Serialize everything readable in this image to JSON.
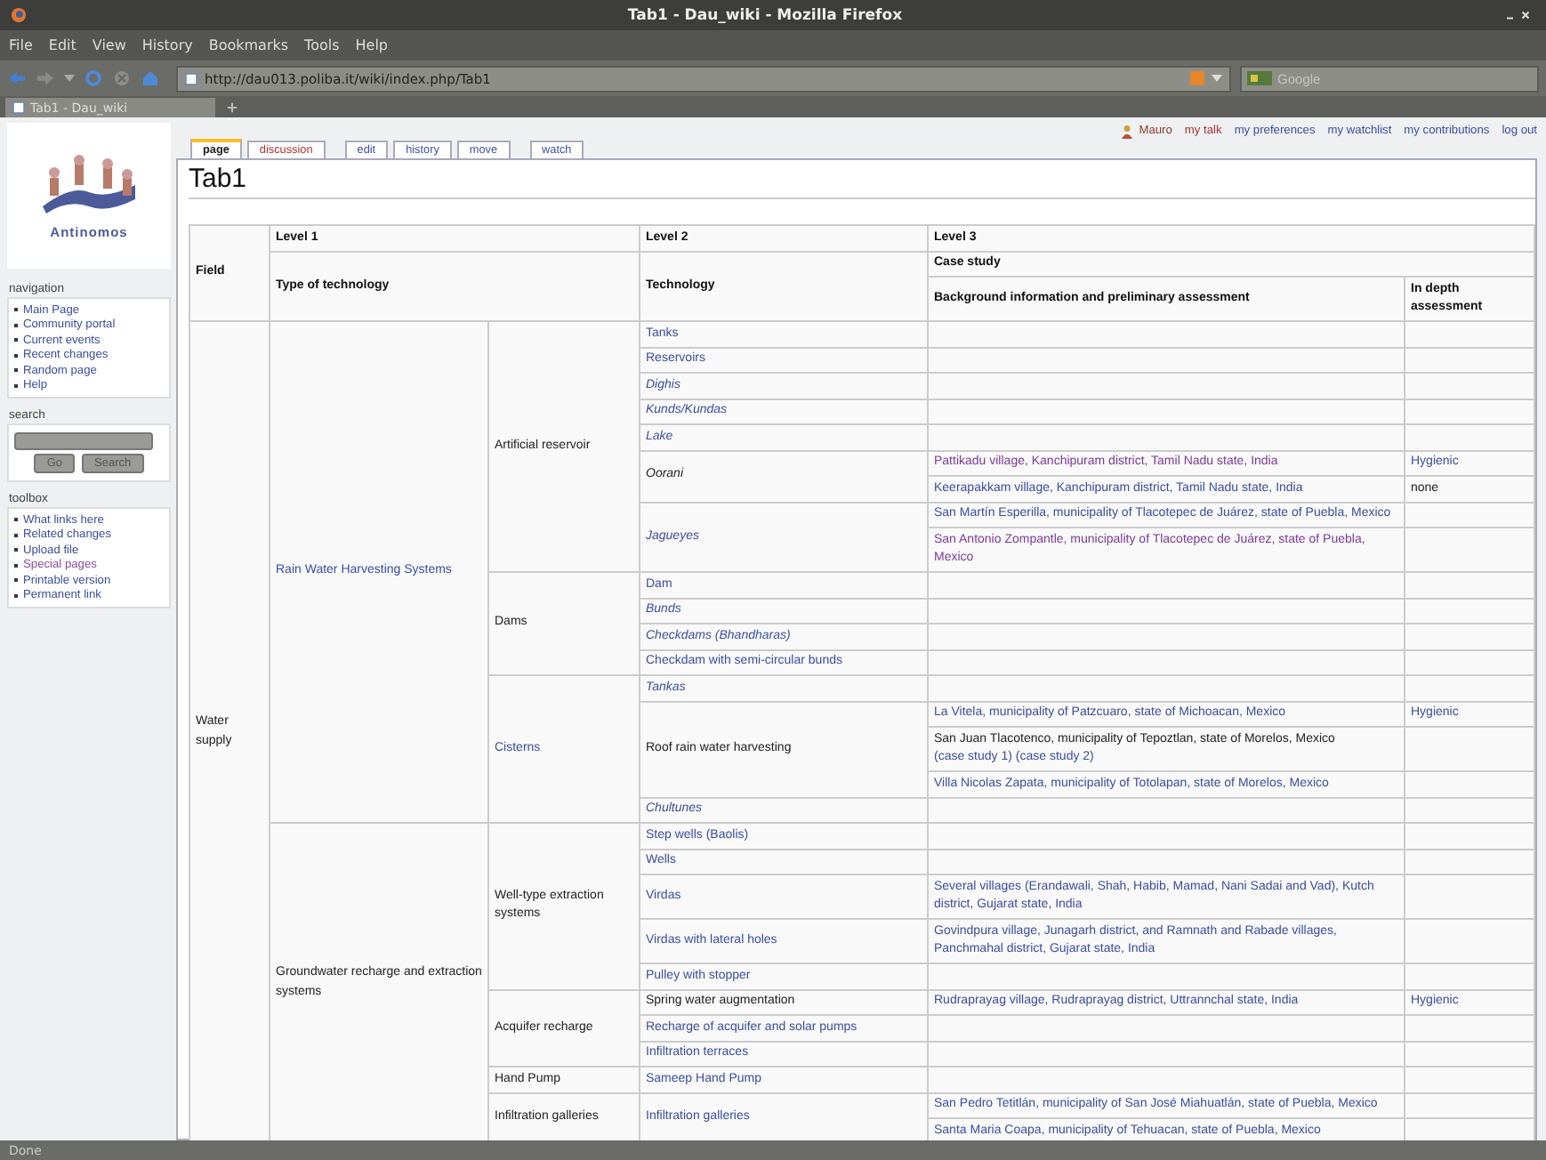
{
  "window": {
    "title": "Tab1 - Dau_wiki - Mozilla Firefox"
  },
  "menu": [
    "File",
    "Edit",
    "View",
    "History",
    "Bookmarks",
    "Tools",
    "Help"
  ],
  "address": "http://dau013.poliba.it/wiki/index.php/Tab1",
  "search": {
    "placeholder": "Google"
  },
  "browser_tabs": [
    {
      "label": "Tab1 - Dau_wiki",
      "selected": true
    }
  ],
  "user_links": [
    {
      "label": "Mauro",
      "kind": "user"
    },
    {
      "label": "my talk",
      "kind": "new"
    },
    {
      "label": "my preferences",
      "kind": "link"
    },
    {
      "label": "my watchlist",
      "kind": "link"
    },
    {
      "label": "my contributions",
      "kind": "link"
    },
    {
      "label": "log out",
      "kind": "link"
    }
  ],
  "page_tabs": [
    {
      "label": "page",
      "selected": true,
      "kind": "link"
    },
    {
      "label": "discussion",
      "selected": false,
      "kind": "new"
    },
    {
      "label": "edit",
      "selected": false,
      "kind": "link"
    },
    {
      "label": "history",
      "selected": false,
      "kind": "link"
    },
    {
      "label": "move",
      "selected": false,
      "kind": "link"
    },
    {
      "label": "watch",
      "selected": false,
      "kind": "link"
    }
  ],
  "page_title": "Tab1",
  "logo": {
    "text": "Antinomos"
  },
  "portlets": [
    {
      "title": "navigation",
      "kind": "links",
      "items": [
        {
          "label": "Main Page",
          "visited": false
        },
        {
          "label": "Community portal",
          "visited": false
        },
        {
          "label": "Current events",
          "visited": false
        },
        {
          "label": "Recent changes",
          "visited": false
        },
        {
          "label": "Random page",
          "visited": false
        },
        {
          "label": "Help",
          "visited": false
        }
      ]
    },
    {
      "title": "search",
      "kind": "search",
      "buttons": [
        "Go",
        "Search"
      ]
    },
    {
      "title": "toolbox",
      "kind": "links",
      "items": [
        {
          "label": "What links here",
          "visited": false
        },
        {
          "label": "Related changes",
          "visited": false
        },
        {
          "label": "Upload file",
          "visited": false
        },
        {
          "label": "Special pages",
          "visited": true
        },
        {
          "label": "Printable version",
          "visited": false
        },
        {
          "label": "Permanent link",
          "visited": false
        }
      ]
    }
  ],
  "table": {
    "headers": {
      "field": "Field",
      "level1": "Level 1",
      "type": "Type of technology",
      "level2": "Level 2",
      "technology": "Technology",
      "level3": "Level 3",
      "case_study": "Case study",
      "background": "Background information and preliminary assessment",
      "depth": "In depth assessment"
    },
    "fields": [
      {
        "name": "Water supply",
        "types": [
          {
            "name": {
              "text": "Rain Water Harvesting Systems",
              "kind": "link"
            },
            "groups": [
              {
                "name": {
                  "text": "Artificial reservoir",
                  "kind": "text"
                },
                "techs": [
                  {
                    "name": {
                      "text": "Tanks",
                      "kind": "link"
                    }
                  },
                  {
                    "name": {
                      "text": "Reservoirs",
                      "kind": "link"
                    }
                  },
                  {
                    "name": {
                      "text": "Dighis",
                      "kind": "italic-link"
                    }
                  },
                  {
                    "name": {
                      "text": "Kunds/Kundas",
                      "kind": "italic-link"
                    }
                  },
                  {
                    "name": {
                      "text": "Lake",
                      "kind": "italic-link"
                    }
                  },
                  {
                    "name": {
                      "text": "Oorani",
                      "kind": "italic"
                    },
                    "cases": [
                      {
                        "parts": [
                          {
                            "text": "Pattikadu village, Kanchipuram district, Tamil Nadu state, India",
                            "kind": "visited-link"
                          }
                        ],
                        "depth": {
                          "text": "Hygienic",
                          "kind": "link"
                        }
                      },
                      {
                        "parts": [
                          {
                            "text": "Keerapakkam village, Kanchipuram district, Tamil Nadu state, India",
                            "kind": "link"
                          }
                        ],
                        "depth": {
                          "text": "none",
                          "kind": "text"
                        }
                      }
                    ]
                  },
                  {
                    "name": {
                      "text": "Jagueyes",
                      "kind": "italic-link"
                    },
                    "cases": [
                      {
                        "parts": [
                          {
                            "text": "San Martín Esperilla, municipality of Tlacotepec de Juárez, state of Puebla, Mexico",
                            "kind": "link"
                          }
                        ]
                      },
                      {
                        "parts": [
                          {
                            "text": "San Antonio Zompantle, municipality of Tlacotepec de Juárez, state of Puebla, Mexico",
                            "kind": "visited-link"
                          }
                        ]
                      }
                    ]
                  }
                ]
              },
              {
                "name": {
                  "text": "Dams",
                  "kind": "text"
                },
                "techs": [
                  {
                    "name": {
                      "text": "Dam",
                      "kind": "link"
                    }
                  },
                  {
                    "name": {
                      "text": "Bunds",
                      "kind": "italic-link"
                    }
                  },
                  {
                    "name": {
                      "text": "Checkdams (Bhandharas)",
                      "kind": "italic-link"
                    }
                  },
                  {
                    "name": {
                      "text": "Checkdam with semi-circular bunds",
                      "kind": "link"
                    }
                  }
                ]
              },
              {
                "name": {
                  "text": "Cisterns",
                  "kind": "link"
                },
                "techs": [
                  {
                    "name": {
                      "text": "Tankas",
                      "kind": "italic-link"
                    }
                  },
                  {
                    "name": {
                      "text": "Roof rain water harvesting",
                      "kind": "text"
                    },
                    "cases": [
                      {
                        "parts": [
                          {
                            "text": "La Vitela, municipality of Patzcuaro, state of Michoacan, Mexico",
                            "kind": "link"
                          }
                        ],
                        "depth": {
                          "text": "Hygienic",
                          "kind": "link"
                        }
                      },
                      {
                        "parts": [
                          {
                            "text": "San Juan Tlacotenco, municipality of Tepoztlan, state of Morelos, Mexico",
                            "kind": "text"
                          },
                          {
                            "text": "(case study 1)",
                            "kind": "link"
                          },
                          {
                            "text": "(case study 2)",
                            "kind": "link"
                          }
                        ]
                      },
                      {
                        "parts": [
                          {
                            "text": "Villa Nicolas Zapata, municipality of Totolapan, state of Morelos, Mexico",
                            "kind": "link"
                          }
                        ]
                      }
                    ]
                  },
                  {
                    "name": {
                      "text": "Chultunes",
                      "kind": "italic-link"
                    }
                  }
                ]
              }
            ]
          },
          {
            "name": {
              "text": "Groundwater recharge and extraction systems",
              "kind": "text"
            },
            "groups": [
              {
                "name": {
                  "text": "Well-type extraction systems",
                  "kind": "text"
                },
                "techs": [
                  {
                    "name": {
                      "text": "Step wells (Baolis)",
                      "kind": "link"
                    }
                  },
                  {
                    "name": {
                      "text": "Wells",
                      "kind": "link"
                    }
                  },
                  {
                    "name": {
                      "text": "Virdas",
                      "kind": "link"
                    },
                    "cases": [
                      {
                        "parts": [
                          {
                            "text": "Several villages (Erandawali, Shah, Habib, Mamad, Nani Sadai and Vad), Kutch district, Gujarat state, India",
                            "kind": "link"
                          }
                        ]
                      }
                    ]
                  },
                  {
                    "name": {
                      "text": "Virdas with lateral holes",
                      "kind": "link"
                    },
                    "cases": [
                      {
                        "parts": [
                          {
                            "text": "Govindpura village, Junagarh district, and Ramnath and Rabade villages, Panchmahal district, Gujarat state, India",
                            "kind": "link"
                          }
                        ]
                      }
                    ]
                  },
                  {
                    "name": {
                      "text": "Pulley with stopper",
                      "kind": "link"
                    }
                  }
                ]
              },
              {
                "name": {
                  "text": "Acquifer recharge",
                  "kind": "text"
                },
                "techs": [
                  {
                    "name": {
                      "text": "Spring water augmentation",
                      "kind": "text"
                    },
                    "cases": [
                      {
                        "parts": [
                          {
                            "text": "Rudraprayag village, Rudraprayag district, Uttrannchal state, India",
                            "kind": "link"
                          }
                        ],
                        "depth": {
                          "text": "Hygienic",
                          "kind": "link"
                        }
                      }
                    ]
                  },
                  {
                    "name": {
                      "text": "Recharge of acquifer and solar pumps",
                      "kind": "link"
                    }
                  },
                  {
                    "name": {
                      "text": "Infiltration terraces",
                      "kind": "link"
                    }
                  }
                ]
              },
              {
                "name": {
                  "text": "Hand Pump",
                  "kind": "text"
                },
                "techs": [
                  {
                    "name": {
                      "text": "Sameep Hand Pump",
                      "kind": "link"
                    }
                  }
                ]
              },
              {
                "name": {
                  "text": "Infiltration galleries",
                  "kind": "text"
                },
                "techs": [
                  {
                    "name": {
                      "text": "Infiltration galleries",
                      "kind": "link"
                    },
                    "cases": [
                      {
                        "parts": [
                          {
                            "text": "San Pedro Tetitlán, municipality of San José Miahuatlán, state of Puebla, Mexico",
                            "kind": "link"
                          }
                        ]
                      },
                      {
                        "parts": [
                          {
                            "text": "Santa Maria Coapa, municipality of Tehuacan, state of Puebla, Mexico",
                            "kind": "link"
                          }
                        ]
                      }
                    ]
                  }
                ]
              }
            ]
          }
        ]
      }
    ]
  },
  "status_bar": "Done"
}
